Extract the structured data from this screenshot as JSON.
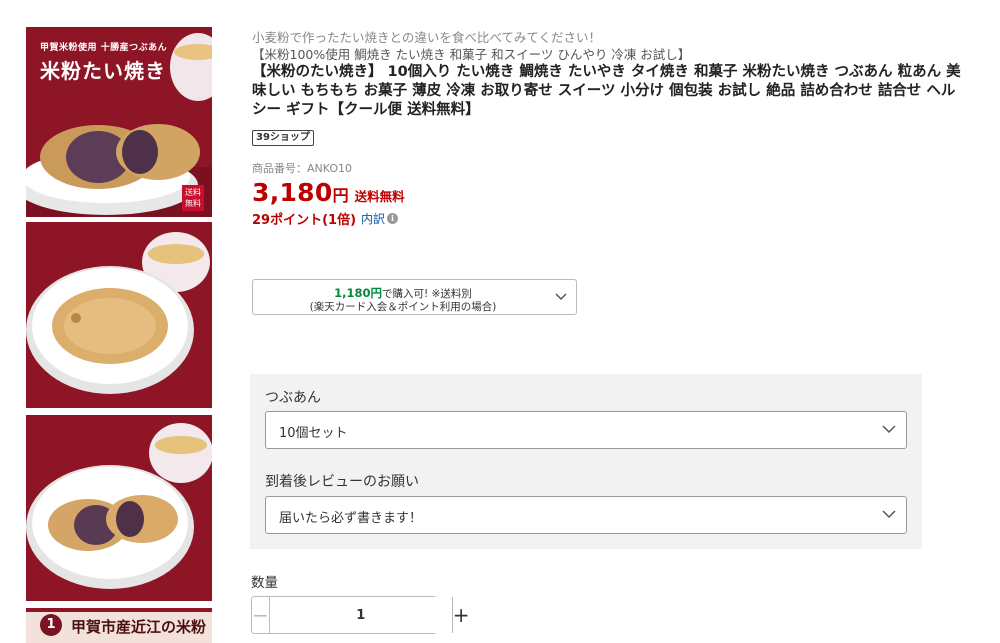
{
  "gallery": {
    "thumb1": {
      "subtitle": "甲賀米粉使用 十勝産つぶあん",
      "title": "米粉たい焼き",
      "badge_line1": "送料",
      "badge_line2": "無料"
    },
    "thumb4": {
      "number": "1",
      "text": "甲賀市産近江の米粉"
    }
  },
  "product": {
    "catchcopy": "小麦粉で作ったたい焼きとの違いを食べ比べてみてください！",
    "subcopy": "【米粉100%使用 鯛焼き たい焼き 和菓子 和スイーツ ひんやり 冷凍 お試し】",
    "title": "【米粉のたい焼き】 10個入り たい焼き 鯛焼き たいやき タイ焼き 和菓子 米粉たい焼き つぶあん 粒あん 美味しい もちもち お菓子 薄皮 冷凍 お取り寄せ スイーツ 小分け 個包装 お試し 絶品 詰め合わせ 詰合せ ヘルシー ギフト【クール便 送料無料】",
    "shop_badge": "39ショップ",
    "item_number": "商品番号：ANKO10",
    "price": "3,180",
    "price_unit": "円",
    "shipping": "送料無料",
    "points": "29ポイント(1倍)",
    "points_breakdown": "内訳",
    "info_icon": "i"
  },
  "promo": {
    "price": "1,180円",
    "line1_suffix": "で購入可! ※送料別",
    "line2": "(楽天カード入会＆ポイント利用の場合)"
  },
  "options": {
    "option1": {
      "label": "つぶあん",
      "value": "10個セット"
    },
    "option2": {
      "label": "到着後レビューのお願い",
      "value": "届いたら必ず書きます！"
    }
  },
  "quantity": {
    "label": "数量",
    "value": "1",
    "minus": "−",
    "plus": "+"
  },
  "colors": {
    "price_red": "#bf0000",
    "promo_green": "#008a3e",
    "link_blue": "#0f54b1",
    "panel_bg": "#f2f2f2"
  }
}
